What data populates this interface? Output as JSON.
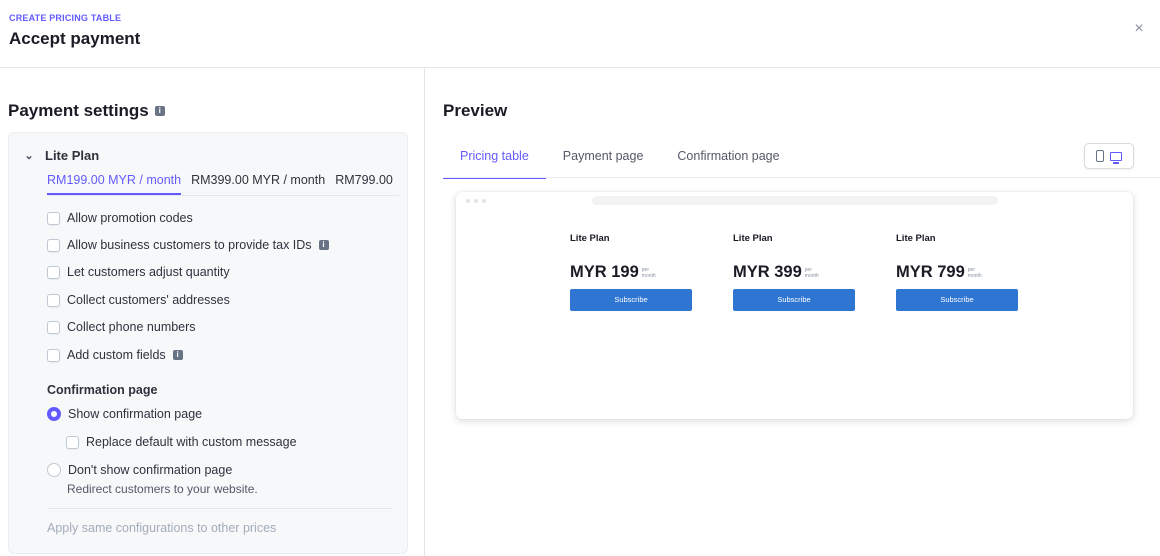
{
  "header": {
    "eyebrow": "CREATE PRICING TABLE",
    "title": "Accept payment",
    "close_glyph": "×"
  },
  "payment_settings": {
    "title": "Payment settings",
    "plan": {
      "name": "Lite Plan",
      "price_tabs": [
        {
          "label": "RM199.00 MYR / month",
          "active": true
        },
        {
          "label": "RM399.00 MYR / month",
          "active": false
        },
        {
          "label": "RM799.00",
          "active": false
        }
      ]
    },
    "options": [
      {
        "label": "Allow promotion codes",
        "checked": false,
        "info": false
      },
      {
        "label": "Allow business customers to provide tax IDs",
        "checked": false,
        "info": true
      },
      {
        "label": "Let customers adjust quantity",
        "checked": false,
        "info": false
      },
      {
        "label": "Collect customers' addresses",
        "checked": false,
        "info": false
      },
      {
        "label": "Collect phone numbers",
        "checked": false,
        "info": false
      },
      {
        "label": "Add custom fields",
        "checked": false,
        "info": true
      }
    ],
    "confirmation": {
      "title": "Confirmation page",
      "show_label": "Show confirmation page",
      "replace_label": "Replace default with custom message",
      "dont_show_label": "Don't show confirmation page",
      "dont_show_sub": "Redirect customers to your website.",
      "selected": "show"
    },
    "apply_label": "Apply same configurations to other prices"
  },
  "preview": {
    "title": "Preview",
    "tabs": [
      {
        "label": "Pricing table",
        "active": true
      },
      {
        "label": "Payment page",
        "active": false
      },
      {
        "label": "Confirmation page",
        "active": false
      }
    ],
    "plans": [
      {
        "name": "Lite Plan",
        "amount": "MYR 199",
        "unit_top": "per",
        "unit_bottom": "month",
        "button": "Subscribe"
      },
      {
        "name": "Lite Plan",
        "amount": "MYR 399",
        "unit_top": "per",
        "unit_bottom": "month",
        "button": "Subscribe"
      },
      {
        "name": "Lite Plan",
        "amount": "MYR 799",
        "unit_top": "per",
        "unit_bottom": "month",
        "button": "Subscribe"
      }
    ],
    "device_mode": "desktop"
  },
  "colors": {
    "accent": "#635bff",
    "subscribe_button": "#2f76d2"
  }
}
